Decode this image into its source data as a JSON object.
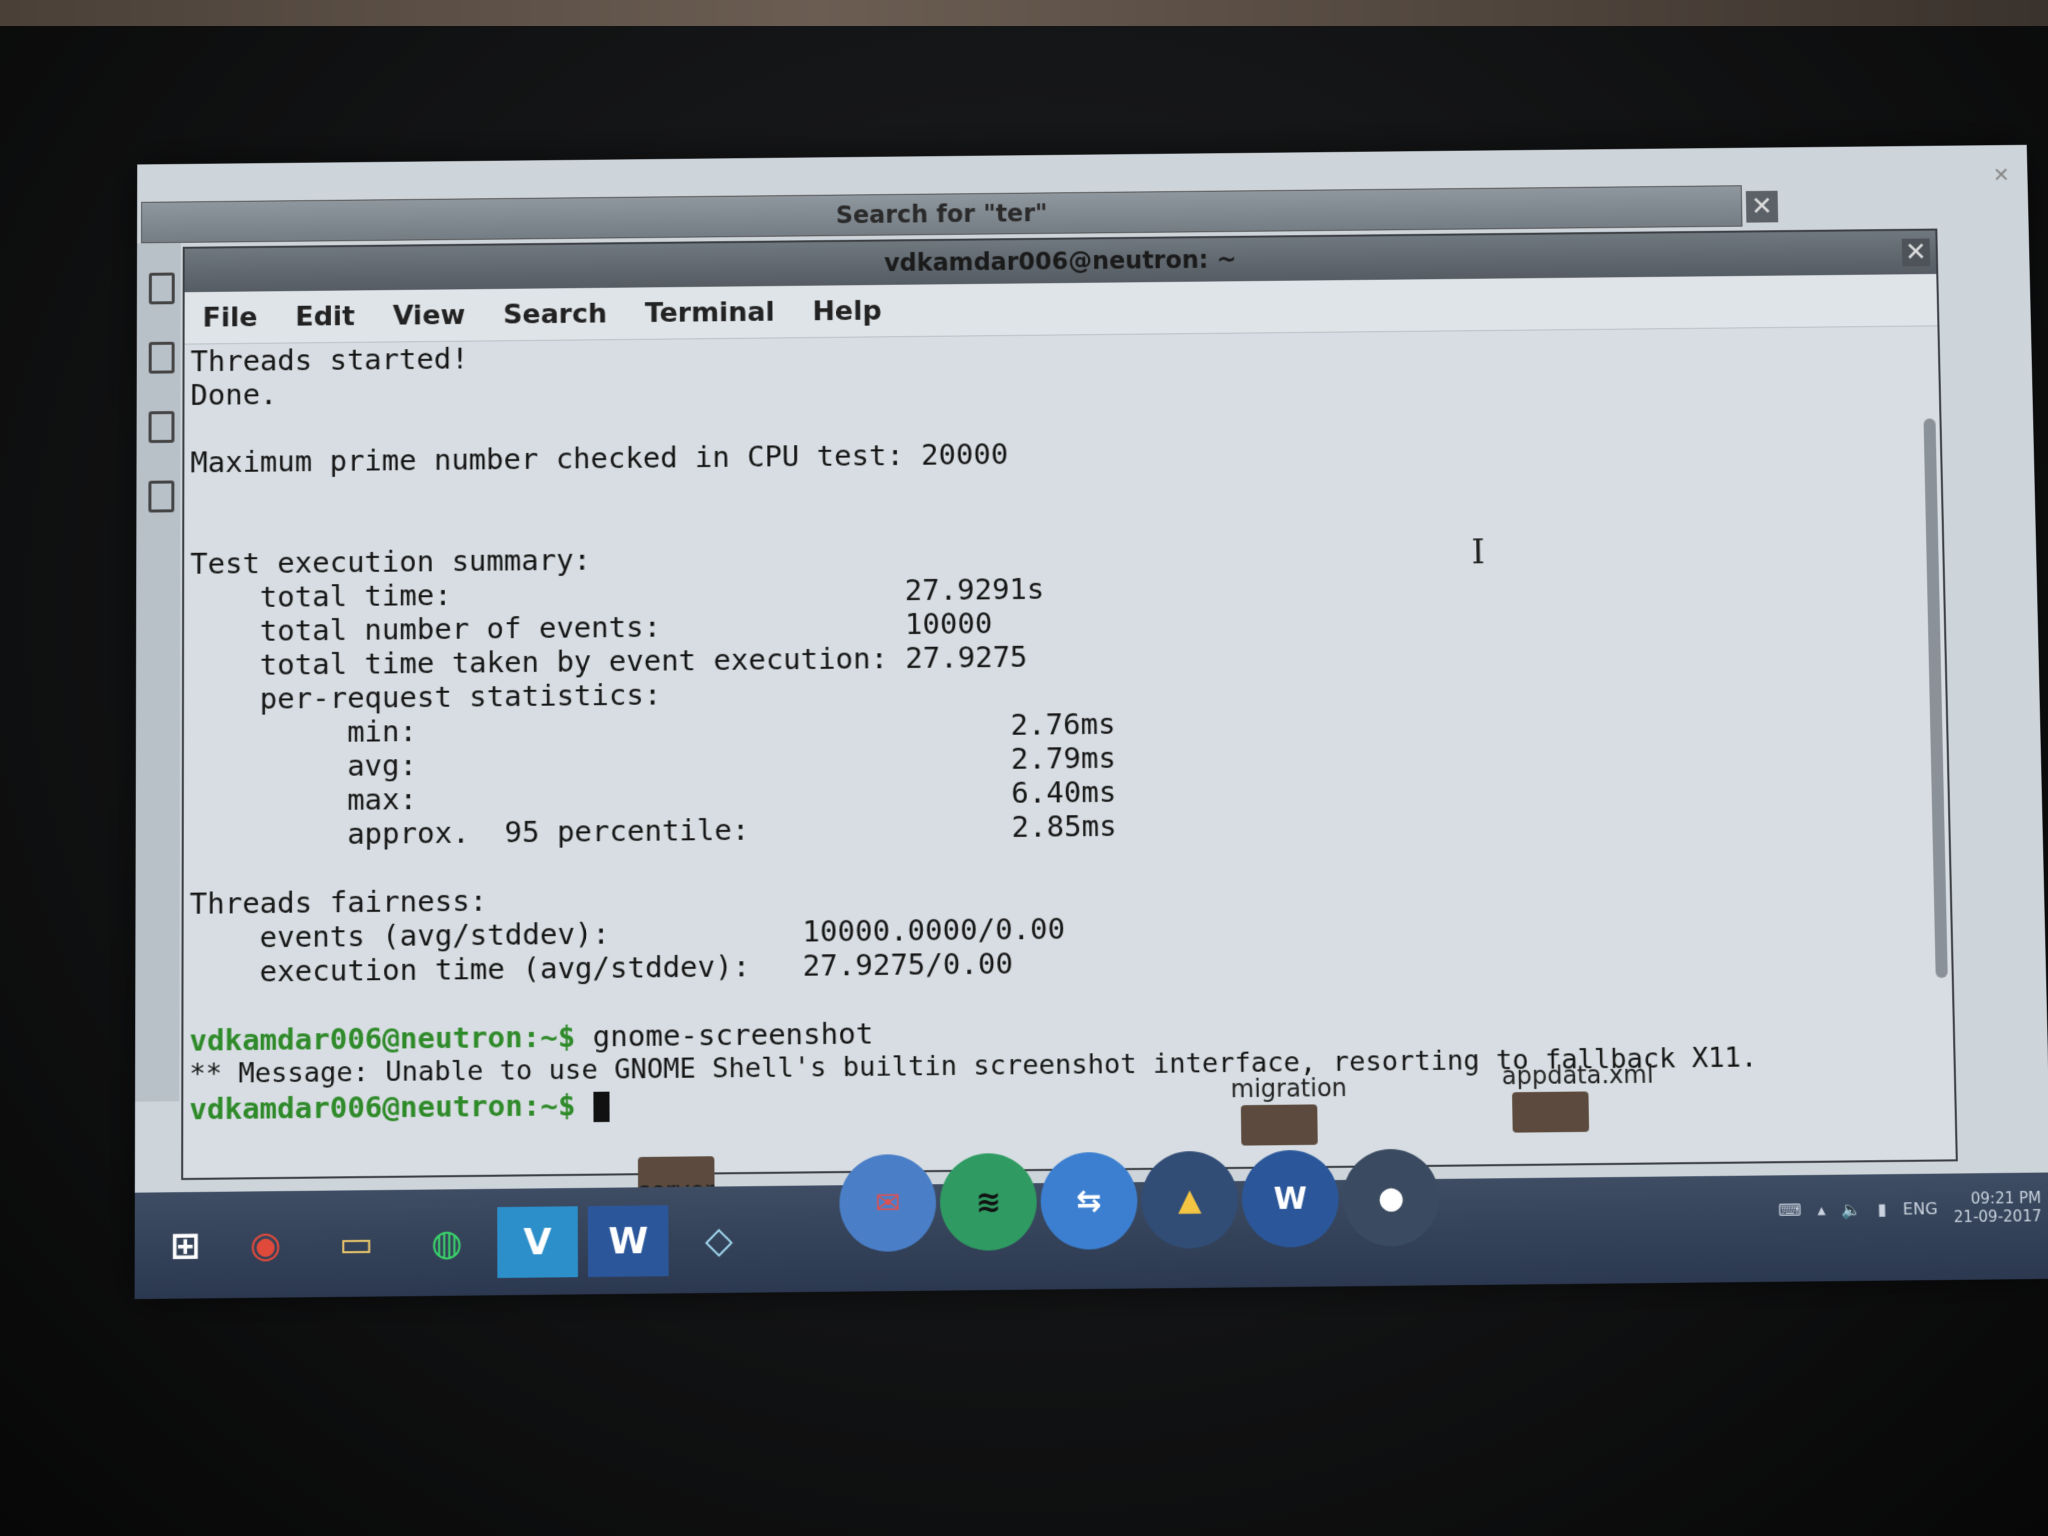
{
  "search_window": {
    "title": "Search for \"ter\""
  },
  "terminal": {
    "title": "vdkamdar006@neutron: ~",
    "menu": [
      "File",
      "Edit",
      "View",
      "Search",
      "Terminal",
      "Help"
    ],
    "lines": [
      "Threads started!",
      "Done.",
      "",
      "Maximum prime number checked in CPU test: 20000",
      "",
      "",
      "Test execution summary:",
      "    total time:                          27.9291s",
      "    total number of events:              10000",
      "    total time taken by event execution: 27.9275",
      "    per-request statistics:",
      "         min:                                  2.76ms",
      "         avg:                                  2.79ms",
      "         max:                                  6.40ms",
      "         approx.  95 percentile:               2.85ms",
      "",
      "Threads fairness:",
      "    events (avg/stddev):           10000.0000/0.00",
      "    execution time (avg/stddev):   27.9275/0.00"
    ],
    "prompt": "vdkamdar006@neutron:~$",
    "command": " gnome-screenshot",
    "message": "** Message: Unable to use GNOME Shell's builtin screenshot interface, resorting to fallback X11."
  },
  "desktop": {
    "labels": [
      "server",
      "migration",
      "appdata.xml"
    ]
  },
  "taskbar": {
    "tray": {
      "lang": "ENG",
      "time": "09:21 PM",
      "date": "21-09-2017"
    }
  },
  "colors": {
    "prompt": "#2f8a2a",
    "taskbar": "#2b3850",
    "terminal_bg": "#d7dde2"
  }
}
